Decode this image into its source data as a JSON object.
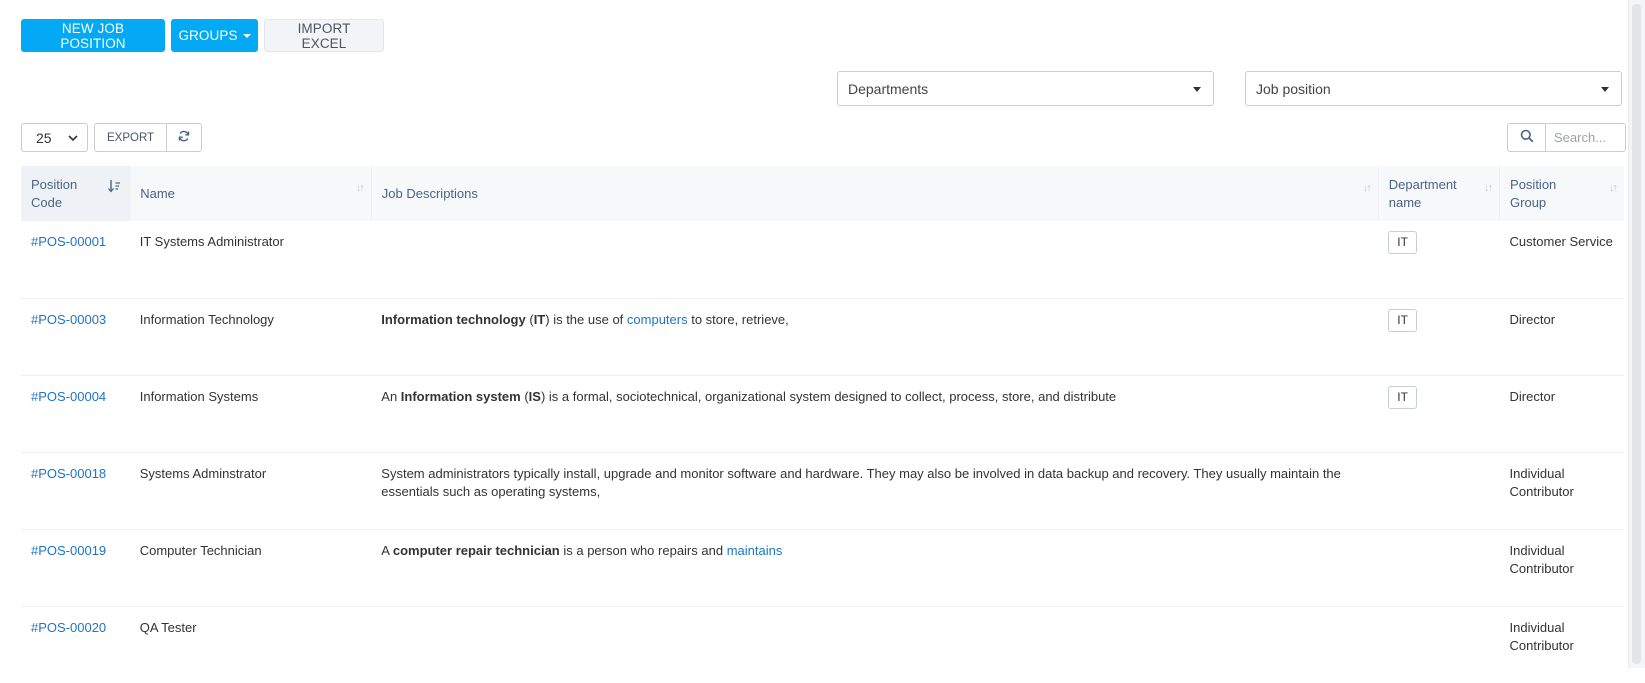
{
  "toolbar": {
    "new_job_position": "NEW JOB POSITION",
    "groups": "GROUPS",
    "import_excel": "IMPORT EXCEL"
  },
  "filters": {
    "departments": "Departments",
    "job_position": "Job position"
  },
  "table_controls": {
    "page_size": "25",
    "export": "EXPORT",
    "search_placeholder": "Search..."
  },
  "columns": {
    "position_code": "Position Code",
    "name": "Name",
    "job_descriptions": "Job Descriptions",
    "department_name": "Department name",
    "position_group": "Position Group"
  },
  "rows": [
    {
      "code": "#POS-00001",
      "name": "IT Systems Administrator",
      "desc": [],
      "dept": "IT",
      "group": "Customer Service"
    },
    {
      "code": "#POS-00003",
      "name": "Information Technology",
      "desc": [
        {
          "t": "Information technology",
          "s": "bold"
        },
        {
          "t": " ("
        },
        {
          "t": "IT",
          "s": "bold"
        },
        {
          "t": ") is the use of "
        },
        {
          "t": "computers",
          "s": "link"
        },
        {
          "t": " to store, retrieve,"
        }
      ],
      "dept": "IT",
      "group": "Director"
    },
    {
      "code": "#POS-00004",
      "name": "Information Systems",
      "desc": [
        {
          "t": "An "
        },
        {
          "t": "Information system",
          "s": "bold"
        },
        {
          "t": " ("
        },
        {
          "t": "IS",
          "s": "bold"
        },
        {
          "t": ") is a formal, sociotechnical, organizational system designed to collect, process, store, and distribute"
        }
      ],
      "dept": "IT",
      "group": "Director"
    },
    {
      "code": "#POS-00018",
      "name": "Systems Adminstrator",
      "desc": [
        {
          "t": "System administrators typically install, upgrade and monitor software and hardware. They may also be involved in data backup and recovery. They usually maintain the essentials such as operating systems,"
        }
      ],
      "dept": "",
      "group": "Individual Contributor"
    },
    {
      "code": "#POS-00019",
      "name": "Computer Technician",
      "desc": [
        {
          "t": "A "
        },
        {
          "t": "computer repair technician",
          "s": "bold"
        },
        {
          "t": " is a person who repairs and "
        },
        {
          "t": "maintains",
          "s": "link"
        }
      ],
      "dept": "",
      "group": "Individual Contributor"
    },
    {
      "code": "#POS-00020",
      "name": "QA Tester",
      "desc": [],
      "dept": "",
      "group": "Individual Contributor"
    }
  ],
  "icons": {
    "search": "search-icon",
    "refresh": "refresh-icon",
    "sort": "sort-icon",
    "dropdown": "caret-down-icon"
  },
  "colors": {
    "primary": "#03a9f4",
    "link": "#1e74c7",
    "header_text": "#4a6485"
  }
}
